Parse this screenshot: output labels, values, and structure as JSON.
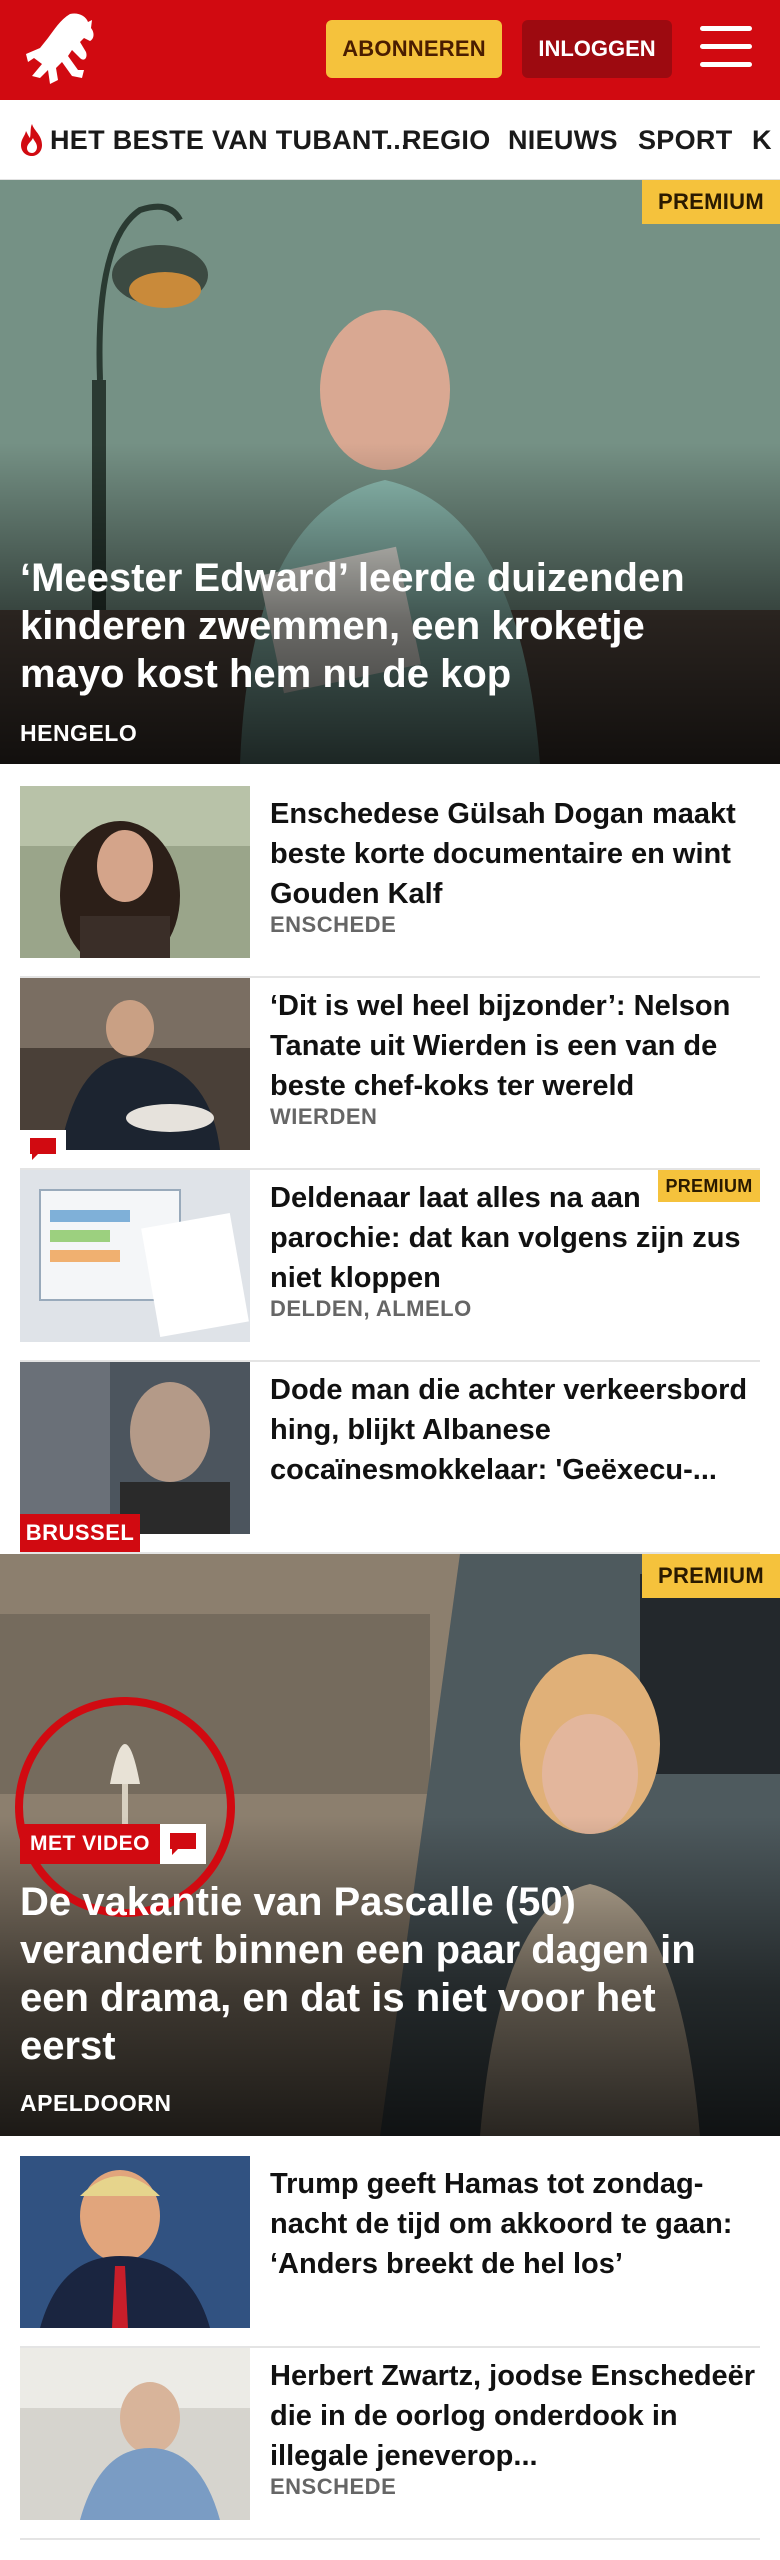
{
  "header": {
    "subscribe_label": "ABONNEREN",
    "login_label": "INLOGGEN",
    "brand_color": "#d10a11"
  },
  "nav": {
    "items": [
      "HET BESTE VAN TUBANT...",
      "REGIO",
      "NIEUWS",
      "SPORT",
      "K"
    ]
  },
  "hero1": {
    "badge": "PREMIUM",
    "title": "‘Meester Edward’ leerde duizenden kinderen zwemmen, een kroketje mayo kost hem nu de kop",
    "location": "HENGELO"
  },
  "list1": [
    {
      "title": "Enschedese Gülsah Dogan maakt beste korte documentaire en wint Gouden Kalf",
      "location": "ENSCHEDE"
    },
    {
      "title": "‘Dit is wel heel bijzonder’: Nelson Tanate uit Wierden is een van de beste chef-koks ter wereld",
      "location": "WIERDEN",
      "has_comments": true
    },
    {
      "title": "Deldenaar laat alles na aan parochie: dat kan volgens zijn zus niet kloppen",
      "location": "DELDEN, ALMELO",
      "badge": "PREMIUM"
    },
    {
      "title": "Dode man die achter verkeers­bord hing, blijkt Albanese cocaïnesmokkelaar: 'Geëxecu-...",
      "location": "",
      "thumb_badge": "BRUSSEL"
    }
  ],
  "hero2": {
    "badge": "PREMIUM",
    "video_label": "MET VIDEO",
    "title": "De vakantie van Pascalle (50) verandert binnen een paar dagen in een drama, en dat is niet voor het eerst",
    "location": "APELDOORN"
  },
  "list2": [
    {
      "title": "Trump geeft Hamas tot zondag­nacht de tijd om akkoord te gaan: ‘Anders breekt de hel los’",
      "location": ""
    },
    {
      "title": "Herbert Zwartz, joodse Enschedeër die in de oorlog onderdook in illegale jeneverop...",
      "location": "ENSCHEDE"
    }
  ]
}
